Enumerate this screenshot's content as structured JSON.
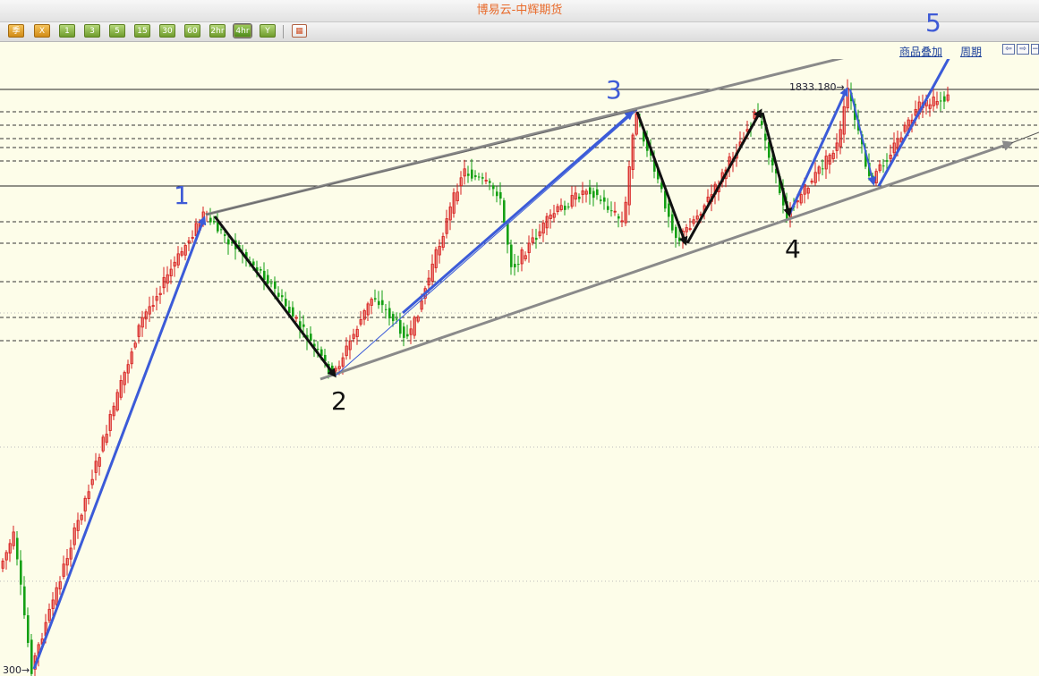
{
  "window": {
    "title": "博易云-中辉期货"
  },
  "toolbar": {
    "buttons": [
      {
        "label": "季",
        "style": "orange"
      },
      {
        "label": "X",
        "style": "orange"
      },
      {
        "label": "1",
        "style": "green"
      },
      {
        "label": "3",
        "style": "green"
      },
      {
        "label": "5",
        "style": "green"
      },
      {
        "label": "15",
        "style": "green"
      },
      {
        "label": "30",
        "style": "green"
      },
      {
        "label": "60",
        "style": "green"
      },
      {
        "label": "2hr",
        "style": "green"
      },
      {
        "label": "4hr",
        "style": "active"
      },
      {
        "label": "Y",
        "style": "green"
      }
    ],
    "calc_icon": "calculator-icon"
  },
  "header_links": {
    "overlay": "商品叠加",
    "period": "周期"
  },
  "nav_icons": [
    "arrow-left-icon",
    "arrow-right-icon",
    "minus-icon"
  ],
  "chart": {
    "high_label": "1833.180",
    "low_label": "300",
    "waves": {
      "w1": "1",
      "w2": "2",
      "w3": "3",
      "w4": "4",
      "w5": "5"
    },
    "colors": {
      "up": "#d81e1e",
      "down": "#14a014",
      "impulse": "#3b5bd8",
      "correction": "#111111",
      "channel": "#8a8a8a"
    }
  }
}
